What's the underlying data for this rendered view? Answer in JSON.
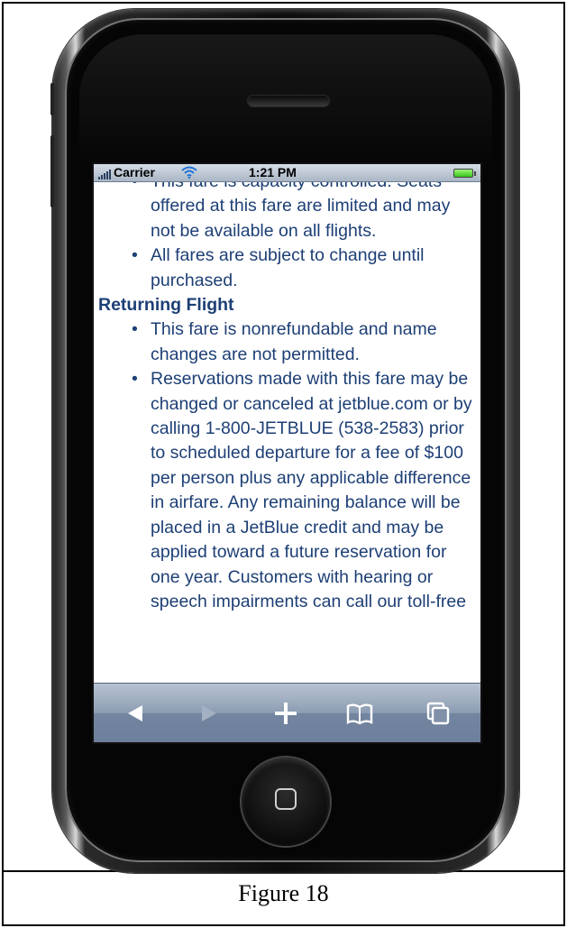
{
  "status_bar": {
    "carrier": "Carrier",
    "time": "1:21 PM",
    "signal_icon": "signal-bars-icon",
    "wifi_icon": "wifi-icon",
    "battery_icon": "battery-icon"
  },
  "content": {
    "outbound_items": [
      "This fare is capacity controlled. Seats offered at this fare are limited and may not be available on all flights.",
      "All fares are subject to change until purchased."
    ],
    "returning_heading": "Returning Flight",
    "returning_items": [
      "This fare is nonrefundable and name changes are not permitted.",
      "Reservations made with this fare may be changed or canceled at jetblue.com or by calling 1-800-JETBLUE (538-2583) prior to scheduled departure for a fee of $100 per person plus any applicable difference in airfare. Any remaining balance will be placed in a JetBlue credit and may be applied toward a future reservation for one year. Customers with hearing or speech impairments can call our toll-free"
    ]
  },
  "toolbar": {
    "back_icon": "back-arrow-icon",
    "forward_icon": "forward-arrow-icon",
    "add_icon": "plus-icon",
    "bookmarks_icon": "bookmarks-book-icon",
    "pages_icon": "pages-icon"
  },
  "colors": {
    "text": "#1d3f75",
    "toolbar": "#8d9db2",
    "statusbar": "#aab6c5"
  },
  "caption": "Figure 18"
}
